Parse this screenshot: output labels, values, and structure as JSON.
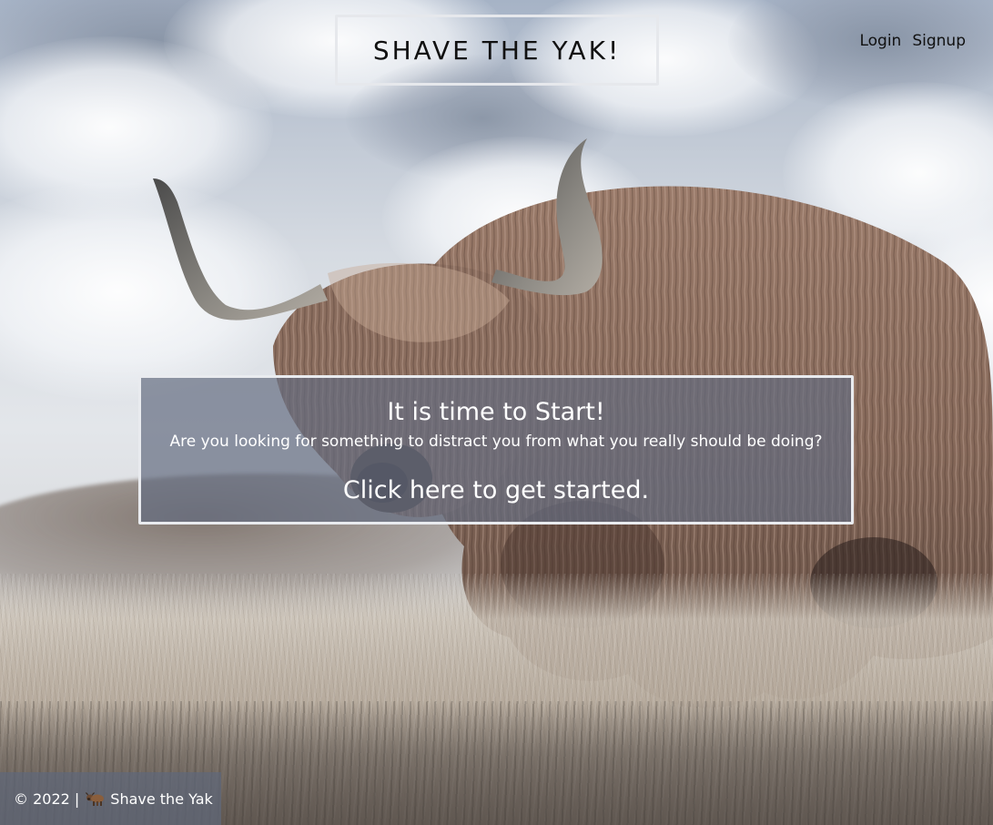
{
  "header": {
    "brand_title": "SHAVE THE YAK!",
    "nav": {
      "login_label": "Login",
      "signup_label": "Signup"
    }
  },
  "hero": {
    "background_image": "highland-yak-photo",
    "card": {
      "heading": "It is time to Start!",
      "subtitle": "Are you looking for something to distract you from what you really should be doing?",
      "cta_label": "Click here to get started."
    }
  },
  "footer": {
    "copyright": "© 2022 |",
    "icon": "yak-icon",
    "site_name": "Shave the Yak"
  },
  "colors": {
    "card_background": "#646c80",
    "card_border": "#e9ebef",
    "text_dark": "#111111",
    "text_light": "#ffffff"
  }
}
